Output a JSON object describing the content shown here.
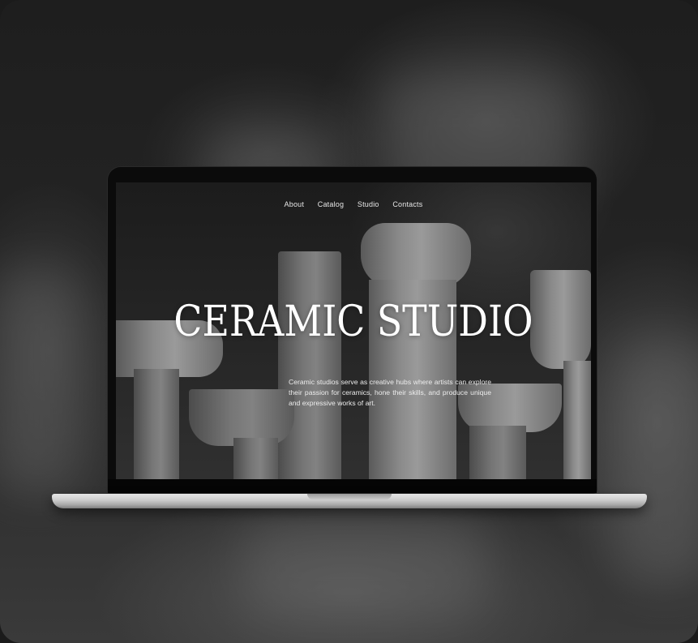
{
  "nav": {
    "items": [
      "About",
      "Catalog",
      "Studio",
      "Contacts"
    ]
  },
  "hero": {
    "title": "CERAMIC STUDIO",
    "description": "Ceramic studios serve as creative hubs where artists can explore their passion for ceramics, hone their skills, and produce unique and expressive works of art."
  },
  "colors": {
    "background": "#1b1b1b",
    "screen": "#262626",
    "text": "#ffffff",
    "laptop_base": "#c9c9c9"
  }
}
